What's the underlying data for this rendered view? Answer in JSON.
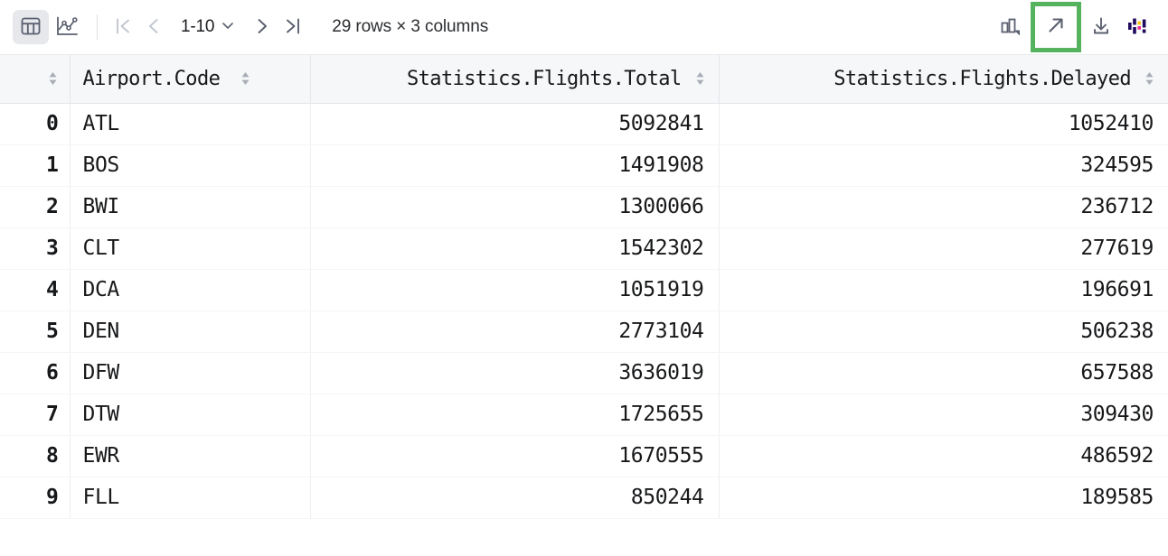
{
  "toolbar": {
    "view_table_icon": "table-grid-icon",
    "view_chart_icon": "line-chart-icon",
    "first_page_icon": "first-page-icon",
    "prev_page_icon": "prev-page-icon",
    "next_page_icon": "next-page-icon",
    "last_page_icon": "last-page-icon",
    "page_range": "1-10",
    "page_range_chevron": "chevron-down-icon",
    "summary": "29 rows × 3 columns",
    "chart_settings_icon": "bar-chart-dropdown-icon",
    "open_in_window_icon": "open-in-new-window-icon",
    "export_icon": "download-icon",
    "dataspell_icon": "jetbrains-dataspell-icon",
    "highlight_color": "#55b35d",
    "active_view": "table"
  },
  "table": {
    "columns": [
      {
        "label": "",
        "name": "index-column",
        "sortable": true,
        "align": "right"
      },
      {
        "label": "Airport.Code",
        "name": "airport-code-column",
        "sortable": true,
        "align": "left"
      },
      {
        "label": "Statistics.Flights.Total",
        "name": "flights-total-column",
        "sortable": true,
        "align": "right"
      },
      {
        "label": "Statistics.Flights.Delayed",
        "name": "flights-delayed-column",
        "sortable": true,
        "align": "right"
      }
    ],
    "rows": [
      {
        "index": "0",
        "code": "ATL",
        "total": "5092841",
        "delayed": "1052410"
      },
      {
        "index": "1",
        "code": "BOS",
        "total": "1491908",
        "delayed": "324595"
      },
      {
        "index": "2",
        "code": "BWI",
        "total": "1300066",
        "delayed": "236712"
      },
      {
        "index": "3",
        "code": "CLT",
        "total": "1542302",
        "delayed": "277619"
      },
      {
        "index": "4",
        "code": "DCA",
        "total": "1051919",
        "delayed": "196691"
      },
      {
        "index": "5",
        "code": "DEN",
        "total": "2773104",
        "delayed": "506238"
      },
      {
        "index": "6",
        "code": "DFW",
        "total": "3636019",
        "delayed": "657588"
      },
      {
        "index": "7",
        "code": "DTW",
        "total": "1725655",
        "delayed": "309430"
      },
      {
        "index": "8",
        "code": "EWR",
        "total": "1670555",
        "delayed": "486592"
      },
      {
        "index": "9",
        "code": "FLL",
        "total": "850244",
        "delayed": "189585"
      }
    ]
  }
}
